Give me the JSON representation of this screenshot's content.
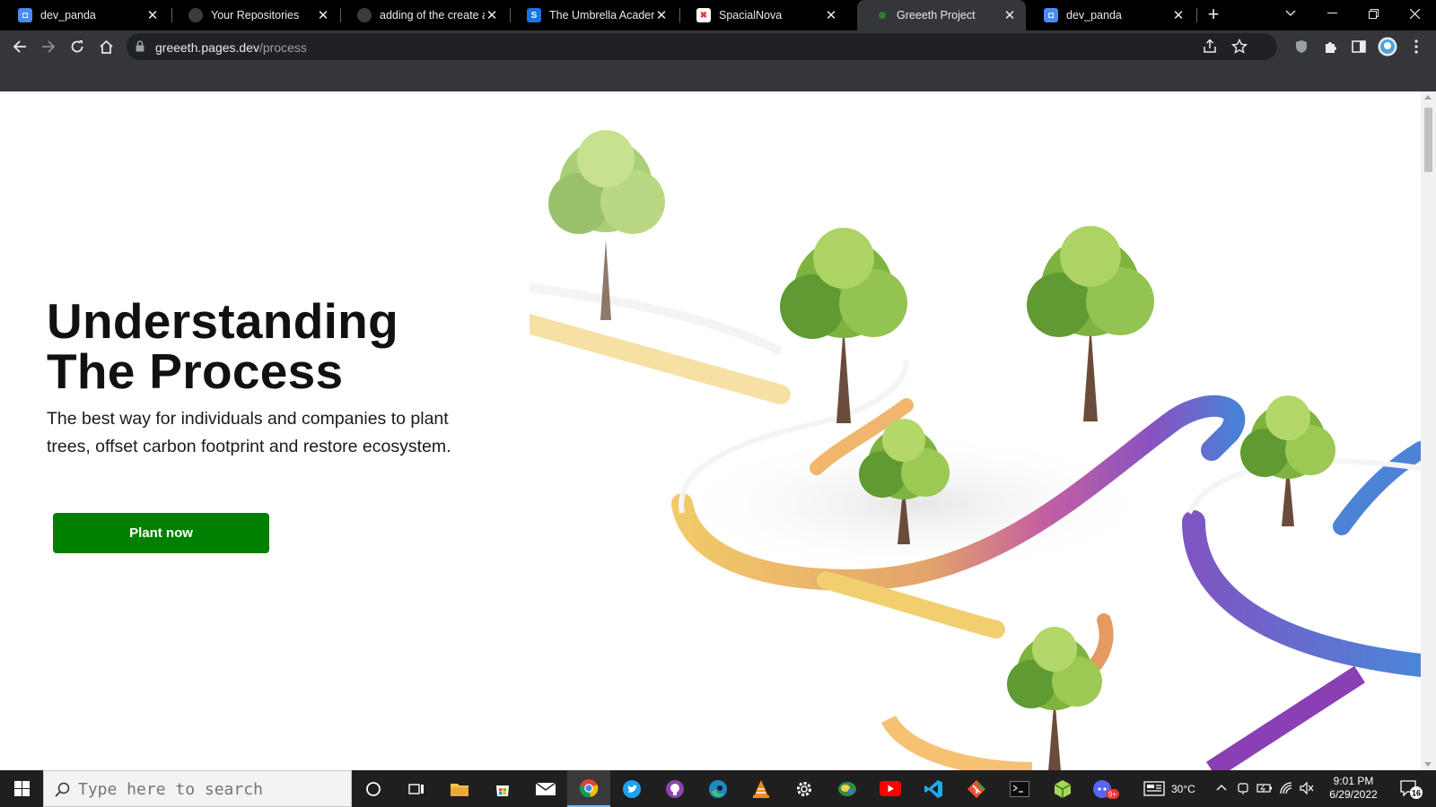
{
  "tabs": [
    {
      "title": "dev_panda",
      "favicon": "dev-profile-icon",
      "color": "#4c8bf5"
    },
    {
      "title": "Your Repositories",
      "favicon": "github-icon",
      "color": "#3c3c3c"
    },
    {
      "title": "adding of the create ac",
      "favicon": "github-icon",
      "color": "#3c3c3c"
    },
    {
      "title": "The Umbrella Academy",
      "favicon": "umbrella-s-icon",
      "color": "#1a73e8"
    },
    {
      "title": "SpacialNova",
      "favicon": "spacialnova-icon",
      "color": "#e53935"
    },
    {
      "title": "Greeeth Project",
      "favicon": "leaf-icon",
      "color": "#2e7d32"
    },
    {
      "title": "dev_panda",
      "favicon": "dev-profile-icon",
      "color": "#4c8bf5"
    }
  ],
  "address": {
    "host": "greeeth.pages.dev",
    "path": "/process"
  },
  "hero": {
    "title_line1": "Understanding",
    "title_line2": "The Process",
    "subtitle_line1": "The best way for individuals and companies to plant",
    "subtitle_line2": "trees, offset carbon footprint and restore ecosystem.",
    "cta_label": "Plant now",
    "cta_color": "#008000"
  },
  "taskbar": {
    "search_placeholder": "Type here to search",
    "apps": [
      "cortana-icon",
      "task-view-icon",
      "file-explorer-icon",
      "store-icon",
      "mail-icon",
      "chrome-icon",
      "twitter-icon",
      "github-icon",
      "edge-icon",
      "vlc-icon",
      "settings-icon",
      "network-app-icon",
      "youtube-icon",
      "vscode-icon",
      "git-icon",
      "terminal-icon",
      "cube-app-icon",
      "discord-icon"
    ],
    "weather": "30°C",
    "time": "9:01 PM",
    "date": "6/29/2022",
    "notification_count": "16",
    "discord_badge": "9+"
  }
}
